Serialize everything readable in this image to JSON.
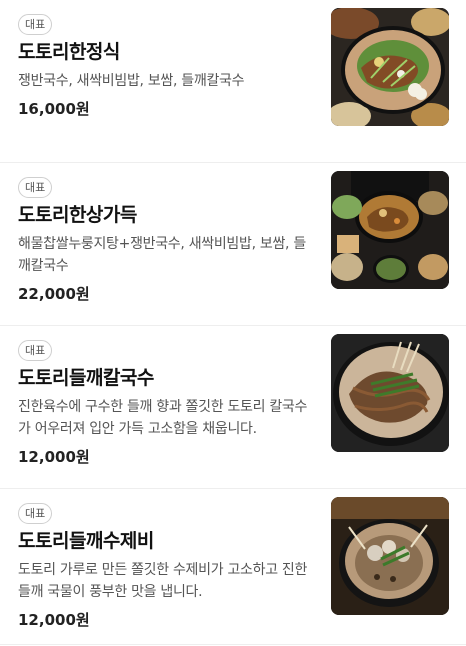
{
  "menu": {
    "items": [
      {
        "badge": "대표",
        "name": "도토리한정식",
        "description": "쟁반국수, 새싹비빔밥, 보쌈, 들깨칼국수",
        "price": "16,000원"
      },
      {
        "badge": "대표",
        "name": "도토리한상가득",
        "description": "해물찹쌀누룽지탕+쟁반국수, 새싹비빔밥, 보쌈, 들깨칼국수",
        "price": "22,000원"
      },
      {
        "badge": "대표",
        "name": "도토리들깨칼국수",
        "description": "진한육수에 구수한 들깨 향과 쫄깃한 도토리 칼국수가 어우러져 입안 가득 고소함을 채웁니다.",
        "price": "12,000원"
      },
      {
        "badge": "대표",
        "name": "도토리들깨수제비",
        "description": "도토리 가루로 만든 쫄깃한 수제비가 고소하고 진한 들깨 국물이 풍부한 맛을 냅니다.",
        "price": "12,000원"
      }
    ]
  }
}
